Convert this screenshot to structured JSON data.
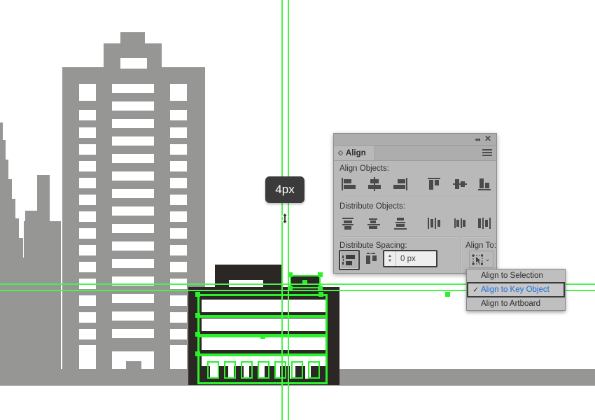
{
  "app": {
    "context": "illustrator-align-panel-over-cityscape-artwork"
  },
  "tooltip": {
    "measurement": "4px",
    "cursor_icon": "double-arrow-vertical-cursor"
  },
  "panel": {
    "title": "Align",
    "collapse_icon": "◂◂",
    "close_icon": "✕",
    "menu_icon": "panel-menu-icon",
    "tab_expand_icon": "◇",
    "sections": {
      "align_objects": {
        "label": "Align Objects:",
        "buttons": [
          {
            "name": "horizontal-align-left",
            "icon": "align-left-icon"
          },
          {
            "name": "horizontal-align-center",
            "icon": "align-hcenter-icon"
          },
          {
            "name": "horizontal-align-right",
            "icon": "align-right-icon"
          },
          {
            "name": "vertical-align-top",
            "icon": "align-top-icon"
          },
          {
            "name": "vertical-align-center",
            "icon": "align-vcenter-icon"
          },
          {
            "name": "vertical-align-bottom",
            "icon": "align-bottom-icon"
          }
        ]
      },
      "distribute_objects": {
        "label": "Distribute Objects:",
        "buttons": [
          {
            "name": "vertical-distribute-top",
            "icon": "distribute-top-icon"
          },
          {
            "name": "vertical-distribute-center",
            "icon": "distribute-vcenter-icon"
          },
          {
            "name": "vertical-distribute-bottom",
            "icon": "distribute-bottom-icon"
          },
          {
            "name": "horizontal-distribute-left",
            "icon": "distribute-left-icon"
          },
          {
            "name": "horizontal-distribute-center",
            "icon": "distribute-hcenter-icon"
          },
          {
            "name": "horizontal-distribute-right",
            "icon": "distribute-right-icon"
          }
        ]
      },
      "distribute_spacing": {
        "label": "Distribute Spacing:",
        "buttons": [
          {
            "name": "vertical-distribute-spacing",
            "icon": "vertical-spacing-icon",
            "pressed": true
          },
          {
            "name": "horizontal-distribute-spacing",
            "icon": "horizontal-spacing-icon",
            "pressed": false
          }
        ],
        "value": "0 px",
        "stepper_up": "▲",
        "stepper_down": "▼"
      },
      "align_to": {
        "label": "Align To:",
        "button_icon": "align-to-key-object-icon",
        "chevron": "⌄"
      }
    }
  },
  "dropdown": {
    "items": [
      {
        "label": "Align to Selection",
        "selected": false,
        "check": ""
      },
      {
        "label": "Align to Key Object",
        "selected": true,
        "check": "✓"
      },
      {
        "label": "Align to Artboard",
        "selected": false,
        "check": ""
      }
    ]
  },
  "colors": {
    "guide_green": "#4cf24c",
    "selection_green": "#2bf12b",
    "building_grey": "#969694",
    "building_dark": "#2b2724",
    "panel_grey": "#b9b9b9",
    "highlight_blue": "#1a6fdd",
    "tooltip_bg": "#3b3b3b"
  },
  "artwork": {
    "title": "city-skyline-vector-artwork",
    "grey_tower": "background-skyscraper",
    "dark_building": "selected-foreground-building",
    "ground": "street-bar"
  }
}
